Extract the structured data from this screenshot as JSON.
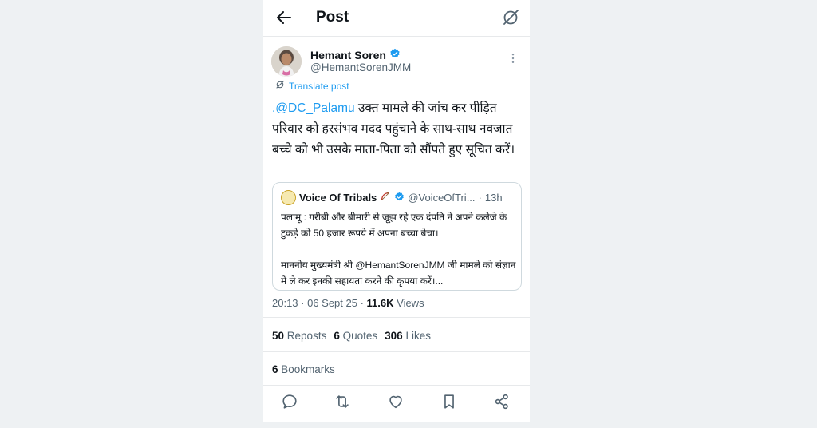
{
  "header": {
    "title": "Post"
  },
  "post": {
    "display_name": "Hemant Soren",
    "handle": "@HemantSorenJMM",
    "translate_label": "Translate post",
    "mention": ".@DC_Palamu",
    "text": " उक्त मामले की जांच कर पीड़ित परिवार को हरसंभव मदद पहुंचाने के साथ-साथ नवजात बच्चे को भी उसके माता-पिता को सौंपते हुए सूचित करें।",
    "timestamp": "20:13 · 06 Sept 25 · ",
    "views_count": "11.6K",
    "views_label": " Views"
  },
  "quoted": {
    "name": "Voice Of Tribals",
    "handle": "@VoiceOfTri...",
    "time": "13h",
    "line1": "पलामू : गरीबी और बीमारी से जूझ रहे एक दंपति ने अपने कलेजे के टुकड़े को 50 हजार रूपये में अपना बच्चा बेचा।",
    "line2": "माननीय मुख्यमंत्री श्री @HemantSorenJMM जी मामले को संज्ञान में ले कर इनकी सहायता करने की कृपया करें।..."
  },
  "stats": {
    "reposts_count": "50",
    "reposts_label": "Reposts",
    "quotes_count": "6",
    "quotes_label": "Quotes",
    "likes_count": "306",
    "likes_label": "Likes",
    "bookmarks_count": "6",
    "bookmarks_label": "Bookmarks"
  },
  "colors": {
    "accent": "#1d9bf0",
    "muted": "#536471"
  },
  "icons": [
    "back-arrow-icon",
    "grok-icon",
    "verified-badge-icon",
    "more-icon",
    "translate-icon",
    "reply-icon",
    "repost-icon",
    "like-icon",
    "bookmark-icon",
    "share-icon"
  ]
}
